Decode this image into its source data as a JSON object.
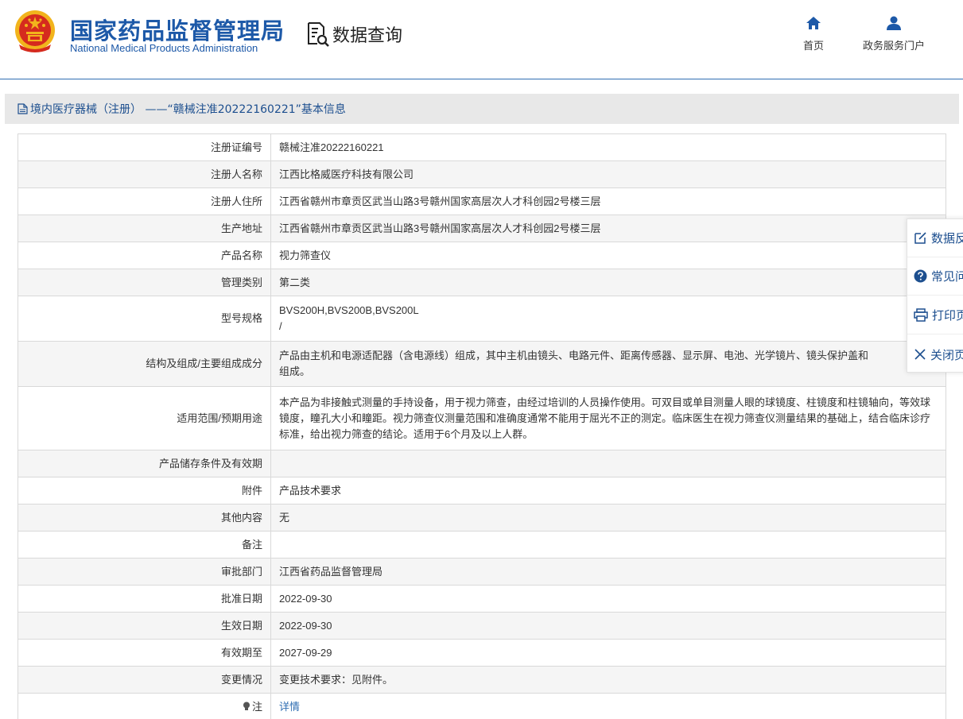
{
  "header": {
    "brand_cn": "国家药品监督管理局",
    "brand_en": "National Medical Products Administration",
    "query_title": "数据查询",
    "nav": {
      "home": "首页",
      "portal": "政务服务门户"
    }
  },
  "title_bar": {
    "text": "境内医疗器械（注册） ——“赣械注准20222160221”基本信息"
  },
  "rows": [
    {
      "label": "注册证编号",
      "value": "赣械注准20222160221"
    },
    {
      "label": "注册人名称",
      "value": "江西比格威医疗科技有限公司"
    },
    {
      "label": "注册人住所",
      "value": "江西省赣州市章贡区武当山路3号赣州国家高层次人才科创园2号楼三层"
    },
    {
      "label": "生产地址",
      "value": "江西省赣州市章贡区武当山路3号赣州国家高层次人才科创园2号楼三层"
    },
    {
      "label": "产品名称",
      "value": "视力筛查仪"
    },
    {
      "label": "管理类别",
      "value": "第二类"
    },
    {
      "label": "型号规格",
      "value": "BVS200H,BVS200B,BVS200L",
      "value2": "/"
    },
    {
      "label": "结构及组成/主要组成成分",
      "value": "产品由主机和电源适配器（含电源线）组成，其中主机由镜头、电路元件、距离传感器、显示屏、电池、光学镜片、镜头保护盖和",
      "value2": "组成。"
    },
    {
      "label": "适用范围/预期用途",
      "value": "本产品为非接触式测量的手持设备，用于视力筛查，由经过培训的人员操作使用。可双目或单目测量人眼的球镜度、柱镜度和柱镜轴向，等效球镜度，瞳孔大小和瞳距。视力筛查仪测量范围和准确度通常不能用于屈光不正的测定。临床医生在视力筛查仪测量结果的基础上，结合临床诊疗标准，给出视力筛查的结论。适用于6个月及以上人群。"
    },
    {
      "label": "产品储存条件及有效期",
      "value": ""
    },
    {
      "label": "附件",
      "value": "产品技术要求"
    },
    {
      "label": "其他内容",
      "value": "无"
    },
    {
      "label": "备注",
      "value": ""
    },
    {
      "label": "审批部门",
      "value": "江西省药品监督管理局"
    },
    {
      "label": "批准日期",
      "value": "2022-09-30"
    },
    {
      "label": "生效日期",
      "value": "2022-09-30"
    },
    {
      "label": "有效期至",
      "value": "2027-09-29"
    },
    {
      "label": "变更情况",
      "value": "变更技术要求：见附件。"
    },
    {
      "label": "注",
      "value": "详情"
    }
  ],
  "float_panel": {
    "items": [
      "数据反馈",
      "常见问题",
      "打印页面",
      "关闭页面"
    ]
  },
  "colors": {
    "brand_blue": "#1d59a8",
    "link_blue": "#2f6eb2",
    "title_bar_bg": "#e8e8e8",
    "emblem_red": "#d52b1e",
    "emblem_gold": "#f2b41c"
  }
}
